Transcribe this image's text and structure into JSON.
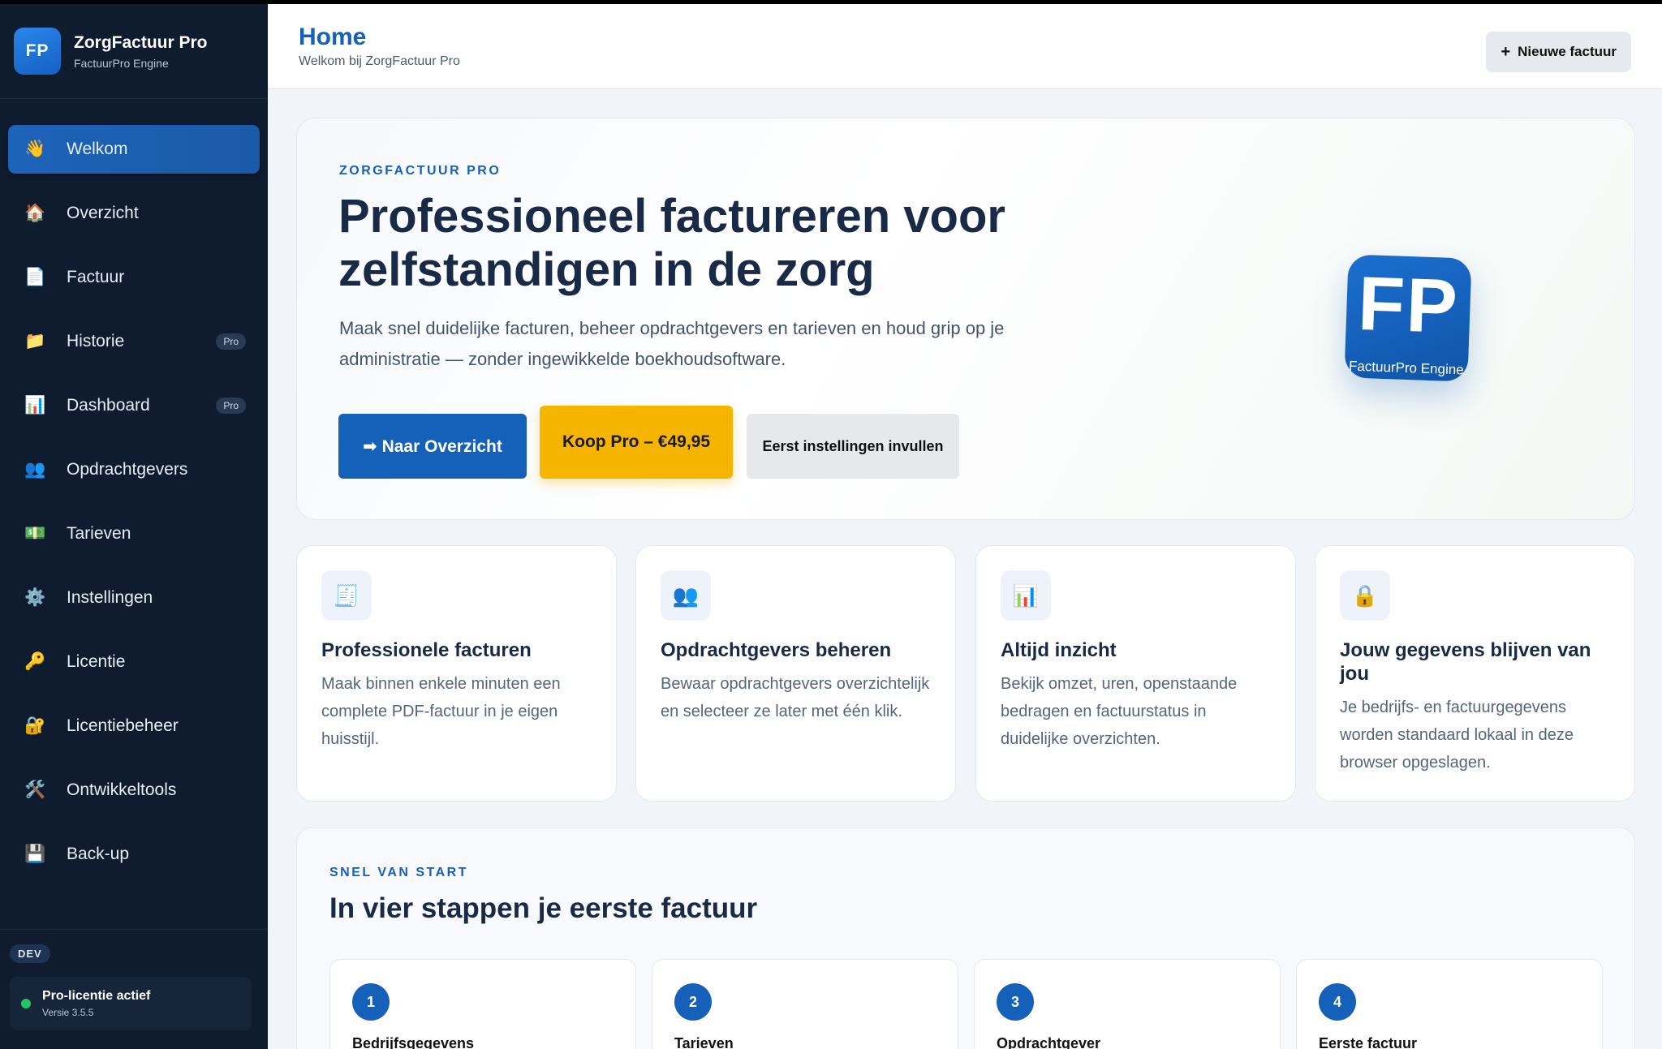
{
  "app": {
    "logo_text": "FP",
    "name": "ZorgFactuur Pro",
    "engine": "FactuurPro Engine"
  },
  "sidebar": {
    "items": [
      {
        "icon": "👋",
        "icon_name": "wave-icon",
        "label": "Welkom",
        "active": true
      },
      {
        "icon": "🏠",
        "icon_name": "home-icon",
        "label": "Overzicht"
      },
      {
        "icon": "📄",
        "icon_name": "document-icon",
        "label": "Factuur"
      },
      {
        "icon": "📁",
        "icon_name": "folder-icon",
        "label": "Historie",
        "badge": "Pro"
      },
      {
        "icon": "📊",
        "icon_name": "chart-icon",
        "label": "Dashboard",
        "badge": "Pro"
      },
      {
        "icon": "👥",
        "icon_name": "users-icon",
        "label": "Opdrachtgevers"
      },
      {
        "icon": "💵",
        "icon_name": "money-icon",
        "label": "Tarieven"
      },
      {
        "icon": "⚙️",
        "icon_name": "gear-icon",
        "label": "Instellingen"
      },
      {
        "icon": "🔑",
        "icon_name": "key-icon",
        "label": "Licentie"
      },
      {
        "icon": "🔐",
        "icon_name": "lock-key-icon",
        "label": "Licentiebeheer"
      },
      {
        "icon": "🛠️",
        "icon_name": "tools-icon",
        "label": "Ontwikkeltools"
      },
      {
        "icon": "💾",
        "icon_name": "floppy-icon",
        "label": "Back-up"
      }
    ],
    "dev_badge": "DEV",
    "licence_status": "Pro-licentie actief",
    "version": "Versie 3.5.5"
  },
  "header": {
    "title": "Home",
    "subtitle": "Welkom bij ZorgFactuur Pro",
    "new_invoice_icon": "+",
    "new_invoice_label": "Nieuwe factuur"
  },
  "hero": {
    "eyebrow": "ZORGFACTUUR PRO",
    "title": "Professioneel factureren voor zelfstandigen in de zorg",
    "text": "Maak snel duidelijke facturen, beheer opdrachtgevers en tarieven en houd grip op je administratie — zonder ingewikkelde boekhoudsoftware.",
    "btn_overview": "➡ Naar Overzicht",
    "btn_pro": "Koop Pro – €49,95",
    "btn_settings": "Eerst instellingen invullen",
    "logo_letters": "FP",
    "logo_sub": "FactuurPro Engine"
  },
  "features": [
    {
      "icon": "🧾",
      "icon_name": "receipt-icon",
      "title": "Professionele facturen",
      "text": "Maak binnen enkele minuten een complete PDF-factuur in je eigen huisstijl."
    },
    {
      "icon": "👥",
      "icon_name": "users-icon",
      "title": "Opdrachtgevers beheren",
      "text": "Bewaar opdrachtgevers overzichtelijk en selecteer ze later met één klik."
    },
    {
      "icon": "📊",
      "icon_name": "chart-icon",
      "title": "Altijd inzicht",
      "text": "Bekijk omzet, uren, openstaande bedragen en factuurstatus in duidelijke overzichten."
    },
    {
      "icon": "🔒",
      "icon_name": "lock-icon",
      "title": "Jouw gegevens blijven van jou",
      "text": "Je bedrijfs- en factuurgegevens worden standaard lokaal in deze browser opgeslagen."
    }
  ],
  "quickstart": {
    "eyebrow": "SNEL VAN START",
    "title": "In vier stappen je eerste factuur",
    "steps": [
      {
        "num": "1",
        "title": "Bedrijfsgegevens"
      },
      {
        "num": "2",
        "title": "Tarieven"
      },
      {
        "num": "3",
        "title": "Opdrachtgever"
      },
      {
        "num": "4",
        "title": "Eerste factuur"
      }
    ]
  },
  "colors": {
    "accent": "#1560b8",
    "sidebar_bg": "#0f1c30",
    "pro_button": "#f4b400",
    "status_active": "#22c55e"
  }
}
